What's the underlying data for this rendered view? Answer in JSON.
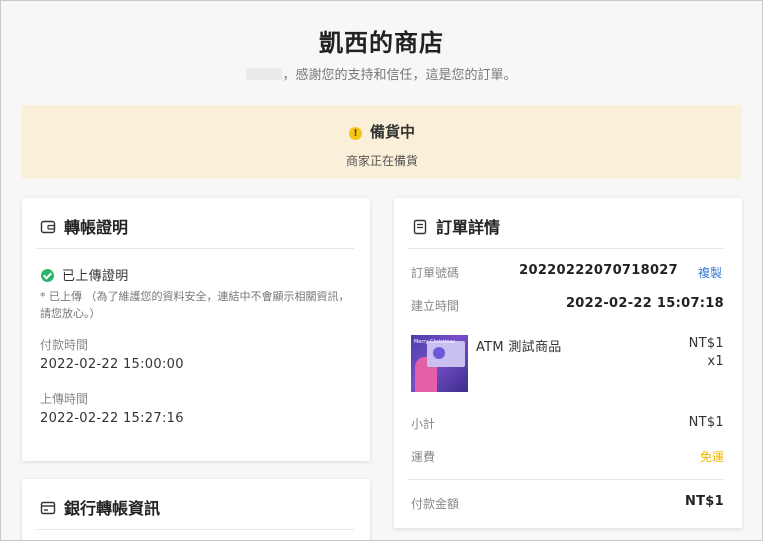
{
  "header": {
    "shop_title": "凱西的商店",
    "thanks_text": "，感謝您的支持和信任，這是您的訂單。"
  },
  "status": {
    "icon": "warning-icon",
    "title": "備貨中",
    "subtitle": "商家正在備貨",
    "colors": {
      "banner_bg": "#faefd8",
      "icon": "#f5c518"
    }
  },
  "transfer_proof": {
    "heading": "轉帳證明",
    "icon": "wallet-icon",
    "uploaded_label": "已上傳證明",
    "note": "* 已上傳 （為了維護您的資料安全，連結中不會顯示相關資訊，請您放心。）",
    "pay_time_label": "付款時間",
    "pay_time_value": "2022-02-22 15:00:00",
    "upload_time_label": "上傳時間",
    "upload_time_value": "2022-02-22 15:27:16"
  },
  "bank_info": {
    "heading": "銀行轉帳資訊",
    "icon": "bank-card-icon"
  },
  "order_details": {
    "heading": "訂單詳情",
    "icon": "document-icon",
    "order_no_label": "訂單號碼",
    "order_no_value": "20220222070718027",
    "copy_label": "複製",
    "created_label": "建立時間",
    "created_value": "2022-02-22 15:07:18",
    "item": {
      "name": "ATM 測試商品",
      "price": "NT$1",
      "qty": "x1",
      "thumb_text": "Merry Christmas"
    },
    "subtotal_label": "小計",
    "subtotal_value": "NT$1",
    "shipping_label": "運費",
    "shipping_value": "免運",
    "total_label": "付款金額",
    "total_value": "NT$1",
    "colors": {
      "link": "#3a7bd5",
      "free_shipping": "#f0b400"
    }
  }
}
